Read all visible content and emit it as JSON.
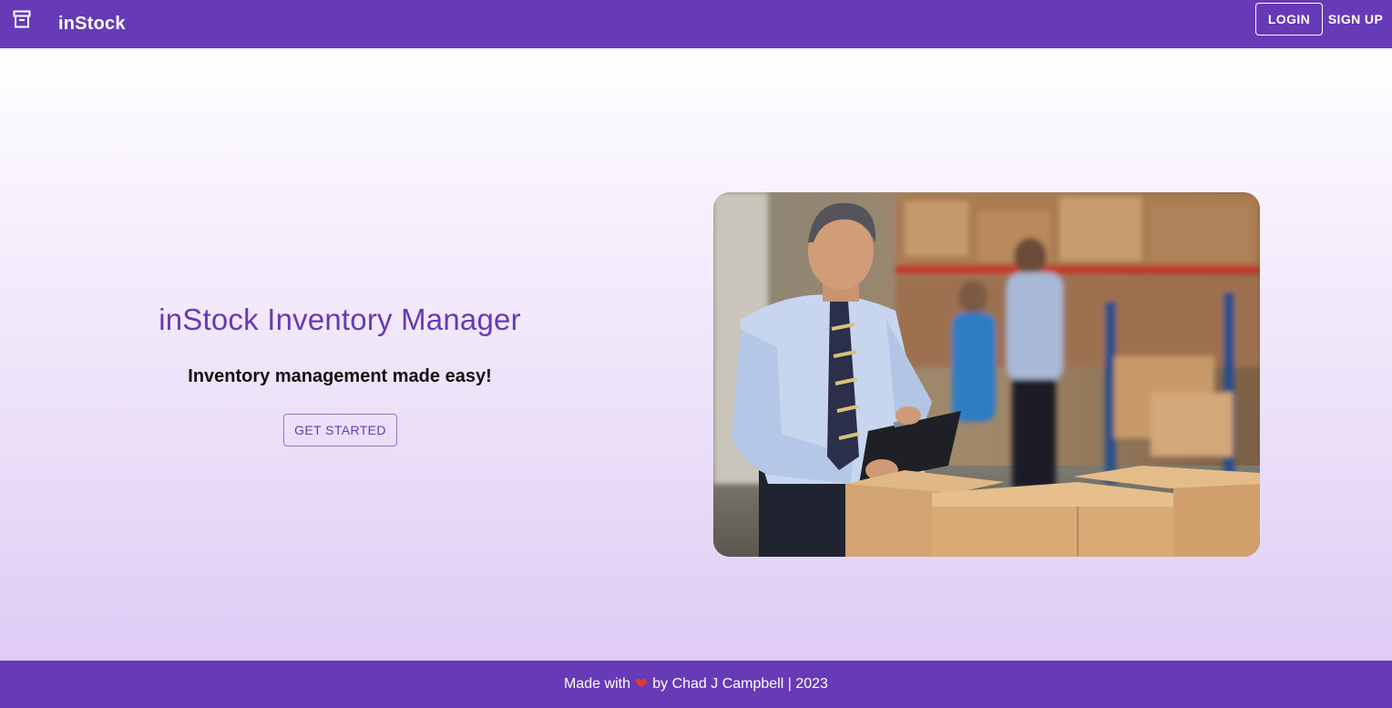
{
  "header": {
    "logo_icon": "archive-box-icon",
    "brand": "inStock",
    "login_label": "LOGIN",
    "signup_label": "SIGN UP"
  },
  "hero": {
    "title": "inStock Inventory Manager",
    "subtitle": "Inventory management made easy!",
    "cta_label": "GET STARTED",
    "image_icon": "warehouse-worker-photo"
  },
  "footer": {
    "prefix": "Made with",
    "heart_icon": "heart-icon",
    "heart": "❤",
    "suffix": "by Chad J Campbell | 2023"
  },
  "colors": {
    "primary": "#673ab7",
    "footer_heart": "#e53935"
  }
}
